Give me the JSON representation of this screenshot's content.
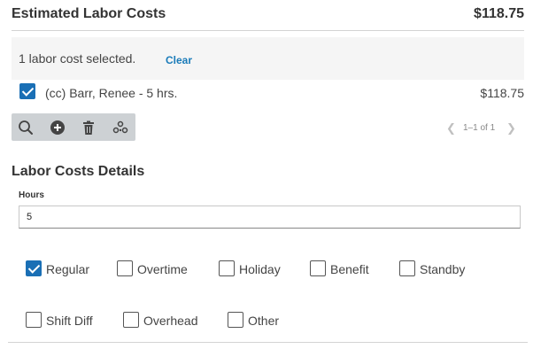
{
  "header": {
    "title": "Estimated Labor Costs",
    "total": "$118.75"
  },
  "selection": {
    "text": "1 labor cost selected.",
    "clear_label": "Clear"
  },
  "labor_items": [
    {
      "label": "(cc) Barr, Renee - 5 hrs.",
      "amount": "$118.75",
      "checked": true
    }
  ],
  "toolbar": {
    "buttons": [
      {
        "icon": "search-icon"
      },
      {
        "icon": "add-circle-icon"
      },
      {
        "icon": "trash-icon"
      },
      {
        "icon": "group-icon"
      }
    ]
  },
  "pager": {
    "count": "1–1 of 1"
  },
  "details": {
    "title": "Labor Costs Details",
    "hours_label": "Hours",
    "hours_value": "5",
    "options": [
      {
        "label": "Regular",
        "checked": true
      },
      {
        "label": "Overtime",
        "checked": false
      },
      {
        "label": "Holiday",
        "checked": false
      },
      {
        "label": "Benefit",
        "checked": false
      },
      {
        "label": "Standby",
        "checked": false
      },
      {
        "label": "Shift Diff",
        "checked": false
      },
      {
        "label": "Overhead",
        "checked": false
      },
      {
        "label": "Other",
        "checked": false
      }
    ]
  },
  "colors": {
    "accent": "#1a6fb5",
    "link": "#1a7bb9",
    "toolbar_bg": "#cdd1d4",
    "selection_bg": "#f5f5f5"
  }
}
